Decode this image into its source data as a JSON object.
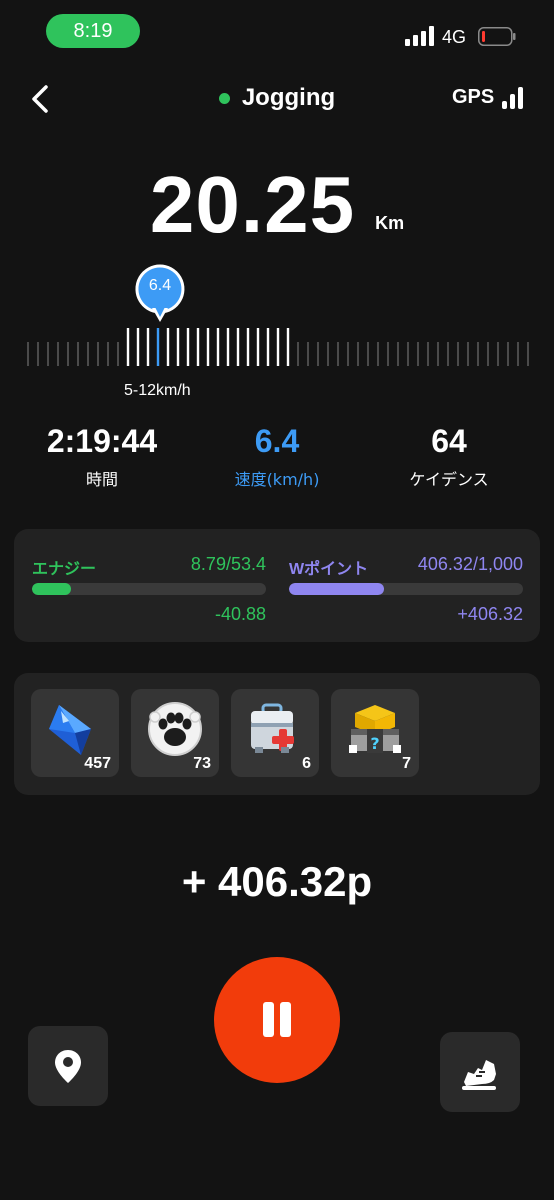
{
  "status_bar": {
    "time": "8:19",
    "network": "4G"
  },
  "header": {
    "mode": "Jogging",
    "gps_label": "GPS"
  },
  "distance": {
    "value": "20.25",
    "unit": "Km"
  },
  "gauge": {
    "current_speed": "6.4",
    "range_label": "5-12km/h",
    "total_ticks": 51,
    "highlight_start": 10,
    "highlight_end": 26,
    "current_tick": 13
  },
  "stats": [
    {
      "value": "2:19:44",
      "label": "時間"
    },
    {
      "value": "6.4",
      "label": "速度(km/h)"
    },
    {
      "value": "64",
      "label": "ケイデンス"
    }
  ],
  "energy": {
    "title": "エナジー",
    "value": "8.79/53.4",
    "fraction": 0.1646,
    "change": "-40.88",
    "color": "#2fc35c"
  },
  "wpoints": {
    "title": "Wポイント",
    "value": "406.32/1,000",
    "fraction": 0.40632,
    "change": "+406.32",
    "color": "#8f86f0"
  },
  "items": [
    {
      "icon": "gem-icon",
      "count": "457"
    },
    {
      "icon": "paw-icon",
      "count": "73"
    },
    {
      "icon": "medkit-icon",
      "count": "6"
    },
    {
      "icon": "mystery-box-icon",
      "count": "7"
    }
  ],
  "earned_points": "+ 406.32p",
  "colors": {
    "accent_green": "#2fc35c",
    "accent_blue": "#3d9bf5",
    "accent_purple": "#8f86f0",
    "pause_red": "#f23c0b"
  }
}
